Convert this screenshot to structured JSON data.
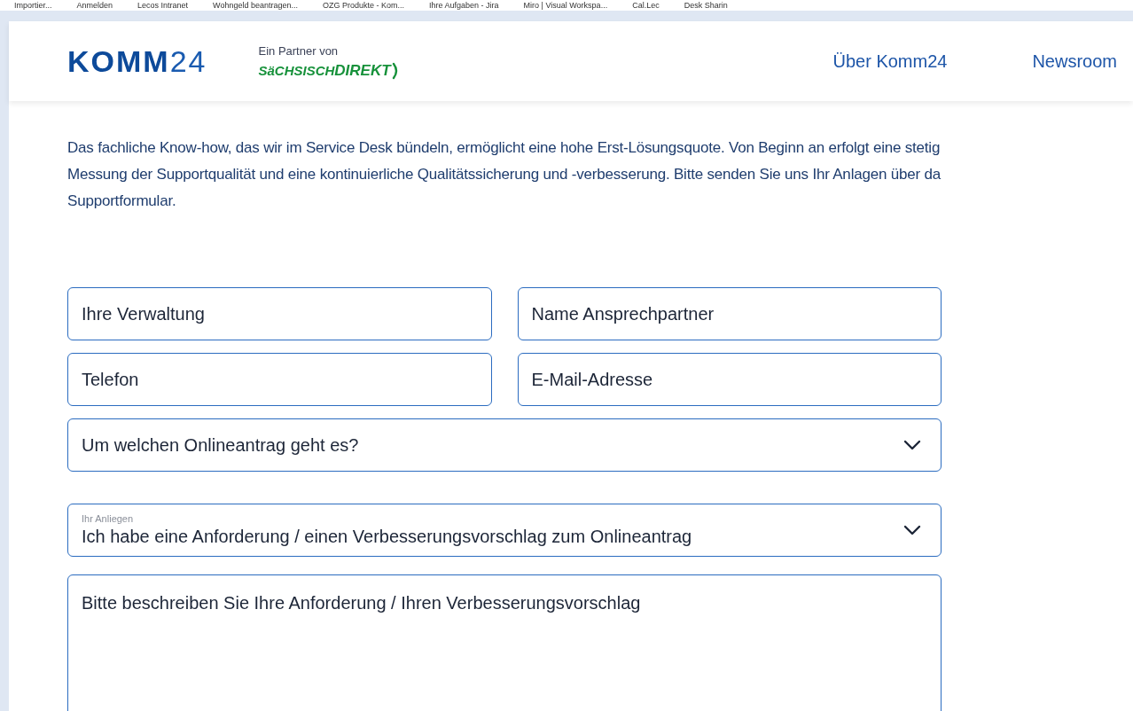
{
  "bookmarks": [
    "Importier...",
    "Anmelden",
    "Lecos Intranet",
    "Wohngeld beantragen...",
    "OZG Produkte - Kom...",
    "Ihre Aufgaben - Jira",
    "Miro | Visual Workspa...",
    "Cal.Lec",
    "Desk Sharin"
  ],
  "header": {
    "logo": {
      "brand": "KOMM",
      "number": "24"
    },
    "partner_label": "Ein Partner von",
    "partner_logo": {
      "part_1": "SäCHSISCH",
      "part_2": "DIREKT"
    },
    "nav": [
      "Über Komm24",
      "Newsroom"
    ]
  },
  "intro_lines": [
    "Das fachliche Know-how, das wir im Service Desk bündeln, ermöglicht eine hohe Erst-Lösungsquote. Von Beginn an erfolgt eine stetig",
    "Messung der Supportqualität und eine kontinuierliche Qualitätssicherung und -verbesserung. Bitte senden Sie uns Ihr Anlagen über da",
    "Supportformular."
  ],
  "form": {
    "fields": [
      {
        "placeholder": "Ihre Verwaltung"
      },
      {
        "placeholder": "Name Ansprechpartner"
      },
      {
        "placeholder": "Telefon"
      },
      {
        "placeholder": "E-Mail-Adresse"
      }
    ],
    "product_select": {
      "placeholder": "Um welchen Onlineantrag geht es?"
    },
    "concern_select": {
      "label": "Ihr Anliegen",
      "value": "Ich habe eine Anforderung / einen Verbesserungsvorschlag zum Onlineantrag"
    },
    "description": {
      "placeholder": "Bitte beschreiben Sie Ihre Anforderung / Ihren Verbesserungsvorschlag"
    }
  }
}
